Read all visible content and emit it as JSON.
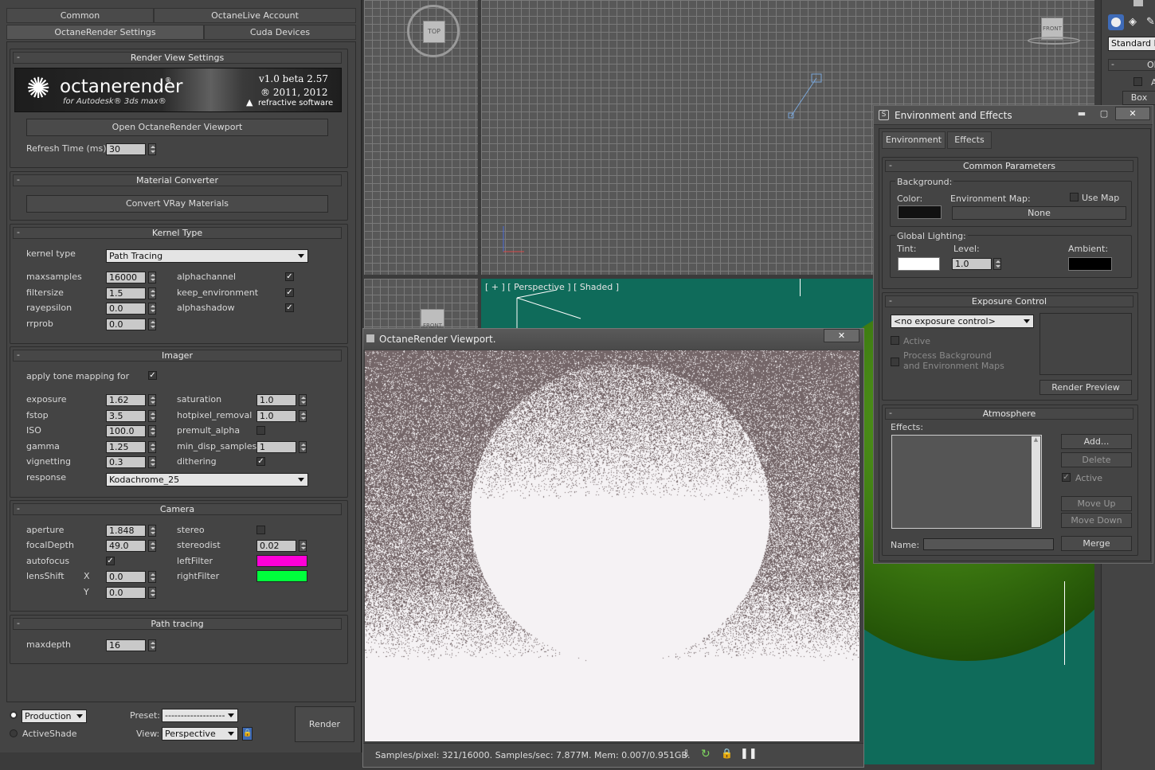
{
  "left_panel": {
    "tabs_row1": [
      "Common",
      "OctaneLive Account"
    ],
    "tabs_row2": [
      "OctaneRender Settings",
      "Cuda Devices"
    ],
    "render_view": {
      "title": "Render View Settings",
      "banner": {
        "brand": "octanerender",
        "reg": "®",
        "sub": "for Autodesk® 3ds max®",
        "version": "v1.0 beta 2.57",
        "copyright": "® 2011, 2012",
        "company": "refractive software"
      },
      "open_viewport": "Open OctaneRender Viewport",
      "refresh_label": "Refresh Time (ms)",
      "refresh_value": "30"
    },
    "material_converter": {
      "title": "Material Converter",
      "convert_button": "Convert VRay Materials"
    },
    "kernel": {
      "title": "Kernel Type",
      "kernel_label": "kernel type",
      "kernel_value": "Path Tracing",
      "params": [
        {
          "label": "maxsamples",
          "value": "16000"
        },
        {
          "label": "filtersize",
          "value": "1.5"
        },
        {
          "label": "rayepsilon",
          "value": "0.0"
        },
        {
          "label": "rrprob",
          "value": "0.0"
        }
      ],
      "checks": [
        {
          "label": "alphachannel",
          "checked": "✓"
        },
        {
          "label": "keep_environment",
          "checked": "✓"
        },
        {
          "label": "alphashadow",
          "checked": "✓"
        }
      ]
    },
    "imager": {
      "title": "Imager",
      "tone_label": "apply tone mapping for",
      "tone_checked": "✓",
      "left_params": [
        {
          "label": "exposure",
          "value": "1.62"
        },
        {
          "label": "fstop",
          "value": "3.5"
        },
        {
          "label": "ISO",
          "value": "100.0"
        },
        {
          "label": "gamma",
          "value": "1.25"
        },
        {
          "label": "vignetting",
          "value": "0.3"
        }
      ],
      "right_params": [
        {
          "label": "saturation",
          "value": "1.0"
        },
        {
          "label": "hotpixel_removal",
          "value": "1.0"
        },
        {
          "label": "premult_alpha",
          "value": ""
        },
        {
          "label": "min_disp_samples",
          "value": "1"
        },
        {
          "label": "dithering",
          "value": "✓"
        }
      ],
      "response_label": "response",
      "response_value": "Kodachrome_25"
    },
    "camera": {
      "title": "Camera",
      "aperture_label": "aperture",
      "aperture": "1.848",
      "focal_label": "focalDepth",
      "focal": "49.0",
      "autofocus_label": "autofocus",
      "autofocus": "✓",
      "lensshift_label": "lensShift",
      "x_label": "X",
      "x_value": "0.0",
      "y_label": "Y",
      "y_value": "0.0",
      "stereo_label": "stereo",
      "stereodist_label": "stereodist",
      "stereodist": "0.02",
      "leftfilter_label": "leftFilter",
      "leftfilter_color": "#ff00d8",
      "rightfilter_label": "rightFilter",
      "rightfilter_color": "#00ff3c"
    },
    "path_tracing": {
      "title": "Path tracing",
      "maxdepth_label": "maxdepth",
      "maxdepth": "16"
    },
    "footer": {
      "production": "Production",
      "activeshade": "ActiveShade",
      "preset_label": "Preset:",
      "preset_value": "-------------------",
      "view_label": "View:",
      "view_value": "Perspective",
      "render_button": "Render"
    }
  },
  "viewports": {
    "top_cube": "TOP",
    "front_cube": "FRONT",
    "front_cube2": "FRONT",
    "perspective_label": "[ + ] [ Perspective ] [ Shaded ]"
  },
  "right_strip": {
    "standard": "Standard Pr",
    "ob": "Ob",
    "a": "A",
    "box": "Box"
  },
  "env_dialog": {
    "title": "Environment and Effects",
    "tabs": [
      "Environment",
      "Effects"
    ],
    "common": {
      "title": "Common Parameters",
      "background": "Background:",
      "color": "Color:",
      "env_map": "Environment Map:",
      "use_map": "Use Map",
      "none": "None",
      "global_lighting": "Global Lighting:",
      "tint": "Tint:",
      "level": "Level:",
      "level_value": "1.0",
      "ambient": "Ambient:"
    },
    "exposure": {
      "title": "Exposure Control",
      "dropdown": "<no exposure control>",
      "active": "Active",
      "process_bg": "Process Background",
      "env_maps": "and Environment Maps",
      "render_preview": "Render Preview"
    },
    "atmosphere": {
      "title": "Atmosphere",
      "effects": "Effects:",
      "add": "Add...",
      "delete": "Delete",
      "active": "Active",
      "move_up": "Move Up",
      "move_down": "Move Down",
      "name": "Name:",
      "merge": "Merge"
    }
  },
  "octane_window": {
    "title": "OctaneRender Viewport.",
    "status": "Samples/pixel: 321/16000. Samples/sec: 7.877M. Mem: 0.007/0.951GB."
  },
  "colors": {
    "env_bg_color": "#111111",
    "tint_color": "#ffffff",
    "ambient_color": "#000000",
    "teal": "#0f6b5a"
  }
}
